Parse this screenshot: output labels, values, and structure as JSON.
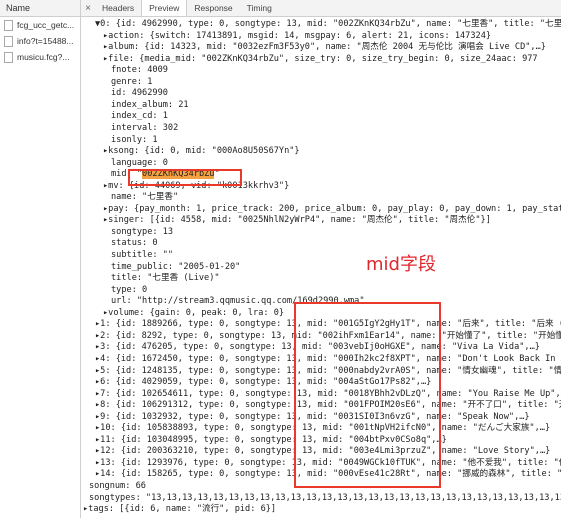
{
  "left_panel": {
    "header": "Name",
    "files": [
      "fcg_ucc_getc...",
      "info?t=15488...",
      "musicu.fcg?..."
    ]
  },
  "tabs": {
    "close_glyph": "×",
    "items": [
      "Headers",
      "Preview",
      "Response",
      "Timing"
    ],
    "active": "Preview"
  },
  "code_lines": [
    {
      "i": 0,
      "indent": 14,
      "text": "▼0: {id: 4962990, type: 0, songtype: 13, mid: \"002ZKnKQ34rbZu\", name: \"七里香\", title: \"七里香"
    },
    {
      "i": 1,
      "indent": 22,
      "text": "▸action: {switch: 17413891, msgid: 14, msgpay: 6, alert: 21, icons: 147324}"
    },
    {
      "i": 2,
      "indent": 22,
      "text": "▸album: {id: 14323, mid: \"0032ezFm3F53y0\", name: \"周杰伦 2004 无与伦比 演唱会 Live CD\",…}"
    },
    {
      "i": 3,
      "indent": 22,
      "text": "▸file: {media_mid: \"002ZKnKQ34rbZu\", size_try: 0, size_try_begin: 0, size_24aac: 977"
    },
    {
      "i": 4,
      "indent": 30,
      "text": "fnote: 4009"
    },
    {
      "i": 5,
      "indent": 30,
      "text": "genre: 1"
    },
    {
      "i": 6,
      "indent": 30,
      "text": "id: 4962990"
    },
    {
      "i": 7,
      "indent": 30,
      "text": "index_album: 21"
    },
    {
      "i": 8,
      "indent": 30,
      "text": "index_cd: 1"
    },
    {
      "i": 9,
      "indent": 30,
      "text": "interval: 302"
    },
    {
      "i": 10,
      "indent": 30,
      "text": "isonly: 1"
    },
    {
      "i": 11,
      "indent": 22,
      "text": "▸ksong: {id: 0, mid: \"000Ao8U50S67Yn\"}"
    },
    {
      "i": 12,
      "indent": 30,
      "text": "language: 0"
    },
    {
      "i": 13,
      "indent": 30,
      "text": "mid: \"002ZKnKQ34rbZu\""
    },
    {
      "i": 14,
      "indent": 22,
      "text": "▸mv: {id: 44069, vid: \"k0013kkrhv3\"}"
    },
    {
      "i": 15,
      "indent": 30,
      "text": "name: \"七里香\""
    },
    {
      "i": 16,
      "indent": 22,
      "text": "▸pay: {pay_month: 1, price_track: 200, price_album: 0, pay_play: 0, pay_down: 1, pay_status"
    },
    {
      "i": 17,
      "indent": 22,
      "text": "▸singer: [{id: 4558, mid: \"0025NhlN2yWrP4\", name: \"周杰伦\", title: \"周杰伦\"}]"
    },
    {
      "i": 18,
      "indent": 30,
      "text": "songtype: 13"
    },
    {
      "i": 19,
      "indent": 30,
      "text": "status: 0"
    },
    {
      "i": 20,
      "indent": 30,
      "text": "subtitle: \"\""
    },
    {
      "i": 21,
      "indent": 30,
      "text": "time_public: \"2005-01-20\""
    },
    {
      "i": 22,
      "indent": 30,
      "text": "title: \"七里香 (Live)\""
    },
    {
      "i": 23,
      "indent": 30,
      "text": "type: 0"
    },
    {
      "i": 24,
      "indent": 30,
      "text": "url: \"http://stream3.qqmusic.qq.com/169d2990.wma\""
    },
    {
      "i": 25,
      "indent": 22,
      "text": "▸volume: {gain: 0, peak: 0, lra: 0}"
    },
    {
      "i": 26,
      "indent": 14,
      "text": "▸1: {id: 1889266, type: 0, songtype: 13, mid: \"001G5IgY2gHy1T\", name: \"后来\", title: \"后来 (Li"
    },
    {
      "i": 27,
      "indent": 14,
      "text": "▸2: {id: 8292, type: 0, songtype: 13, mid: \"002ihFxm1Ear14\", name: \"开始懂了\", title: \"开始懂了"
    },
    {
      "i": 28,
      "indent": 14,
      "text": "▸3: {id: 476205, type: 0, songtype: 13, mid: \"003vebIj0oHGXE\", name: \"Viva La Vida\",…}"
    },
    {
      "i": 29,
      "indent": 14,
      "text": "▸4: {id: 1672450, type: 0, songtype: 13, mid: \"000Ih2kc2f8XPT\", name: \"Don't Look Back In Ang"
    },
    {
      "i": 30,
      "indent": 14,
      "text": "▸5: {id: 1248135, type: 0, songtype: 13, mid: \"000nabdy2vrA0S\", name: \"情女幽魂\", title: \"情女"
    },
    {
      "i": 31,
      "indent": 14,
      "text": "▸6: {id: 4029059, type: 0, songtype: 13, mid: \"004aStGo17Ps82\",…}"
    },
    {
      "i": 32,
      "indent": 14,
      "text": "▸7: {id: 102654611, type: 0, songtype: 13, mid: \"0018YBhh2vDLzQ\", name: \"You Raise Me Up\",…}"
    },
    {
      "i": 33,
      "indent": 14,
      "text": "▸8: {id: 106291312, type: 0, songtype: 13, mid: \"001FPOIM20sE6\", name: \"开不了口\", title: \"开"
    },
    {
      "i": 34,
      "indent": 14,
      "text": "▸9: {id: 1032932, type: 0, songtype: 13, mid: \"0031SI0I3n6vzG\", name: \"Speak Now\",…}"
    },
    {
      "i": 35,
      "indent": 14,
      "text": "▸10: {id: 105838893, type: 0, songtype: 13, mid: \"001tNpVH2ifcN0\", name: \"だんご大家族\",…}"
    },
    {
      "i": 36,
      "indent": 14,
      "text": "▸11: {id: 103048995, type: 0, songtype: 13, mid: \"004btPxv0CSo8q\",…}"
    },
    {
      "i": 37,
      "indent": 14,
      "text": "▸12: {id: 200363210, type: 0, songtype: 13, mid: \"003e4Lmi3przuZ\", name: \"Love Story\",…}"
    },
    {
      "i": 38,
      "indent": 14,
      "text": "▸13: {id: 1293976, type: 0, songtype: 13, mid: \"0049WGCk10fTUK\", name: \"他不爱我\", title: \"他不"
    },
    {
      "i": 39,
      "indent": 14,
      "text": "▸14: {id: 158265, type: 0, songtype: 13, mid: \"000vEse41c28Rt\", name: \"挪威的森林\", title: \"挪"
    },
    {
      "i": 40,
      "indent": 8,
      "text": "songnum: 66"
    },
    {
      "i": 41,
      "indent": 8,
      "text": "songtypes: \"13,13,13,13,13,13,13,13,13,13,13,13,13,13,13,13,13,13,13,13,13,13,13,13,13,13,13"
    },
    {
      "i": 42,
      "indent": 2,
      "text": "▸tags: [{id: 6, name: \"流行\", pid: 6}]"
    }
  ],
  "annotation": {
    "label": "mid字段",
    "highlight_text": "002ZKnKQ34rbZu"
  }
}
